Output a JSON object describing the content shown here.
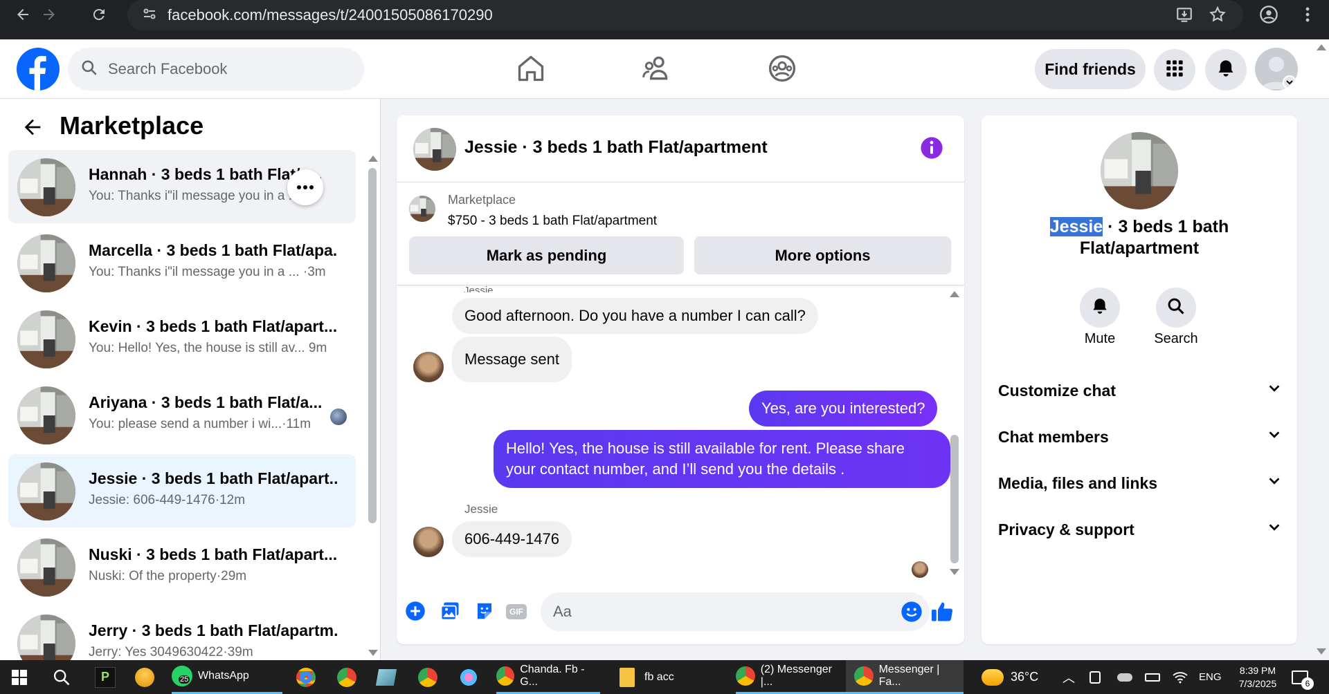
{
  "browser": {
    "url": "facebook.com/messages/t/24001505086170290",
    "icons": [
      "back-icon",
      "forward-icon",
      "reload-icon",
      "site-info-icon",
      "install-icon",
      "star-icon",
      "profile-icon",
      "menu-icon"
    ]
  },
  "fb": {
    "search_placeholder": "Search Facebook",
    "find_friends": "Find friends"
  },
  "left": {
    "title": "Marketplace",
    "conversations": [
      {
        "name": "Hannah · 3 beds 1 bath Flat/a...",
        "snippet": "You: Thanks i\"il message you in a ...",
        "time": "m"
      },
      {
        "name": "Marcella · 3 beds 1 bath Flat/apa...",
        "snippet": "You: Thanks i\"il message you in a ...",
        "time": "·3m"
      },
      {
        "name": "Kevin · 3 beds 1 bath Flat/apart...",
        "snippet": "You: Hello! Yes, the house is still av...",
        "time": "9m"
      },
      {
        "name": "Ariyana · 3 beds 1 bath Flat/a...",
        "snippet": "You: please send a number i wi...",
        "time": "·11m"
      },
      {
        "name": "Jessie · 3 beds 1 bath Flat/apart...",
        "snippet": "Jessie: 606-449-1476",
        "time": "·12m"
      },
      {
        "name": "Nuski · 3 beds 1 bath Flat/apart...",
        "snippet": "Nuski: Of the property",
        "time": "·29m"
      },
      {
        "name": "Jerry · 3 beds 1 bath Flat/apartm...",
        "snippet": "Jerry: Yes 3049630422",
        "time": "·39m"
      }
    ]
  },
  "chat": {
    "title": "Jessie · 3 beds 1 bath Flat/apartment",
    "listing_label": "Marketplace",
    "listing_title": "$750 - 3 beds 1 bath Flat/apartment",
    "mark_pending": "Mark as pending",
    "more_options": "More options",
    "sender_top": "Jessie",
    "messages": {
      "m1": "Good afternoon. Do you have a number I can call?",
      "m2": "Message sent",
      "m3": "Yes, are you interested?",
      "m4_l1": "Hello! Yes, the house is still available for rent. Please share",
      "m4_l2": "your contact number, and I’ll send you the details .",
      "sender2": "Jessie",
      "m5": "606-449-1476"
    },
    "composer_placeholder": "Aa"
  },
  "right": {
    "name_highlight": "Jessie",
    "name_rest": " · 3 beds 1 bath",
    "name_line2": "Flat/apartment",
    "mute": "Mute",
    "search": "Search",
    "rows": [
      "Customize chat",
      "Chat members",
      "Media, files and links",
      "Privacy & support"
    ]
  },
  "taskbar": {
    "whatsapp": "WhatsApp",
    "whatsapp_badge": "25",
    "chrome1": "Chanda. Fb - G...",
    "folder": "fb acc",
    "chrome2": "(2) Messenger |...",
    "chrome3": "Messenger | Fa...",
    "temp": "36°C",
    "lang": "ENG",
    "time": "8:39 PM",
    "date": "7/3/2025",
    "notif": "6"
  },
  "colors": {
    "fb_blue": "#0866ff",
    "messenger_purple": "#7b2ff7",
    "selected_row": "#ebf5ff",
    "hover_row": "#f0f2f5"
  }
}
